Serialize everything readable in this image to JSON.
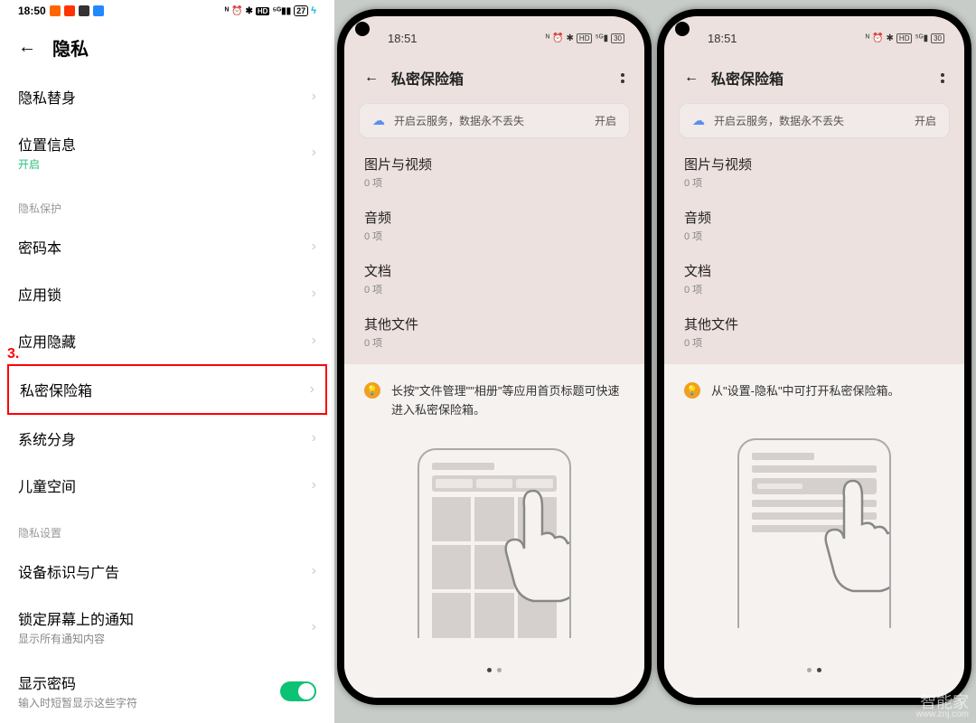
{
  "left": {
    "status": {
      "time": "18:50",
      "battery": "27"
    },
    "title": "隐私",
    "step_label": "3.",
    "rows": [
      {
        "label": "隐私替身",
        "sub": ""
      },
      {
        "label": "位置信息",
        "sub": "开启",
        "sub_green": true
      }
    ],
    "section1_title": "隐私保护",
    "section1_rows": [
      {
        "label": "密码本"
      },
      {
        "label": "应用锁"
      },
      {
        "label": "应用隐藏"
      }
    ],
    "highlighted": {
      "label": "私密保险箱"
    },
    "section1_rest": [
      {
        "label": "系统分身"
      },
      {
        "label": "儿童空间"
      }
    ],
    "section2_title": "隐私设置",
    "section2_rows": [
      {
        "label": "设备标识与广告",
        "sub": ""
      },
      {
        "label": "锁定屏幕上的通知",
        "sub": "显示所有通知内容"
      },
      {
        "label": "显示密码",
        "sub": "输入时短暂显示这些字符",
        "toggle": true
      }
    ]
  },
  "phoneA": {
    "status_time": "18:51",
    "title": "私密保险箱",
    "cloud_text": "开启云服务，数据永不丢失",
    "cloud_action": "开启",
    "rows": [
      {
        "title": "图片与视频",
        "sub": "0 项"
      },
      {
        "title": "音频",
        "sub": "0 项"
      },
      {
        "title": "文档",
        "sub": "0 项"
      },
      {
        "title": "其他文件",
        "sub": "0 项"
      }
    ],
    "tip": "长按\"文件管理\"\"相册\"等应用首页标题可快速进入私密保险箱。",
    "grid": true,
    "active_dot": 0
  },
  "phoneB": {
    "status_time": "18:51",
    "title": "私密保险箱",
    "cloud_text": "开启云服务，数据永不丢失",
    "cloud_action": "开启",
    "rows": [
      {
        "title": "图片与视频",
        "sub": "0 项"
      },
      {
        "title": "音频",
        "sub": "0 项"
      },
      {
        "title": "文档",
        "sub": "0 项"
      },
      {
        "title": "其他文件",
        "sub": "0 项"
      }
    ],
    "tip": "从\"设置-隐私\"中可打开私密保险箱。",
    "grid": false,
    "active_dot": 1
  },
  "watermark": {
    "main": "智能家",
    "sub": "www.znj.com"
  }
}
